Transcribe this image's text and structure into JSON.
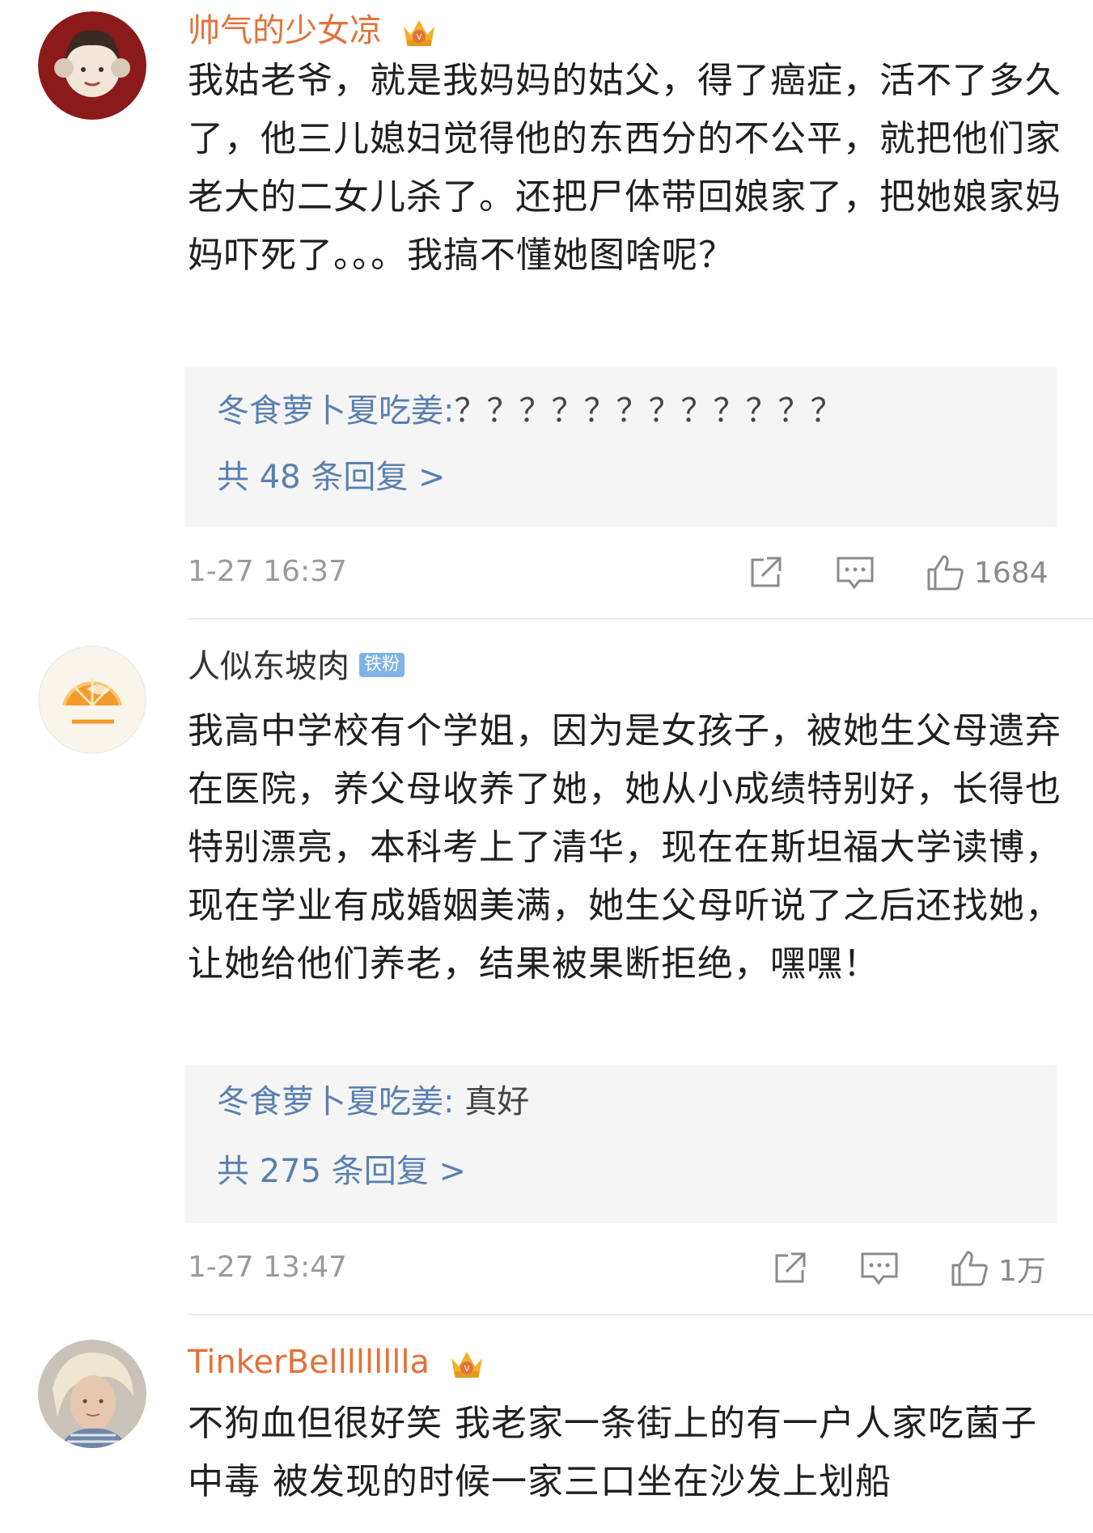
{
  "comments": [
    {
      "username": "帅气的少女凉",
      "badge": "crown-vip-icon",
      "text": "我姑老爷，就是我妈妈的姑父，得了癌症，活不了多久了，他三儿媳妇觉得他的东西分的不公平，就把他们家老大的二女儿杀了。还把尸体带回娘家了，把她娘家妈妈吓死了。。。我搞不懂她图啥呢？",
      "reply_user": "冬食萝卜夏吃姜:",
      "reply_text": "？？？？？？？？？？？？",
      "reply_count": "共 48 条回复 >",
      "timestamp": "1-27 16:37",
      "likes": "1684"
    },
    {
      "username": "人似东坡肉",
      "badge_label": "铁粉",
      "text": "我高中学校有个学姐，因为是女孩子，被她生父母遗弃在医院，养父母收养了她，她从小成绩特别好，长得也特别漂亮，本科考上了清华，现在在斯坦福大学读博，现在学业有成婚姻美满，她生父母听说了之后还找她，让她给他们养老，结果被果断拒绝，嘿嘿！",
      "reply_user": "冬食萝卜夏吃姜:",
      "reply_text": "真好",
      "reply_count": "共 275 条回复 >",
      "timestamp": "1-27 13:47",
      "likes": "1万"
    },
    {
      "username": "TinkerBellllllllla",
      "badge": "crown-vip-icon",
      "text": "不狗血但很好笑 我老家一条街上的有一户人家吃菌子中毒 被发现的时候一家三口坐在沙发上划船"
    }
  ],
  "colors": {
    "vip_name": "#e4713a",
    "reply_user": "#5a7fb0",
    "reply_bg": "#f5f5f5",
    "timestamp": "#9a9a9a"
  },
  "icons": [
    "share-icon",
    "comment-icon",
    "like-icon"
  ]
}
